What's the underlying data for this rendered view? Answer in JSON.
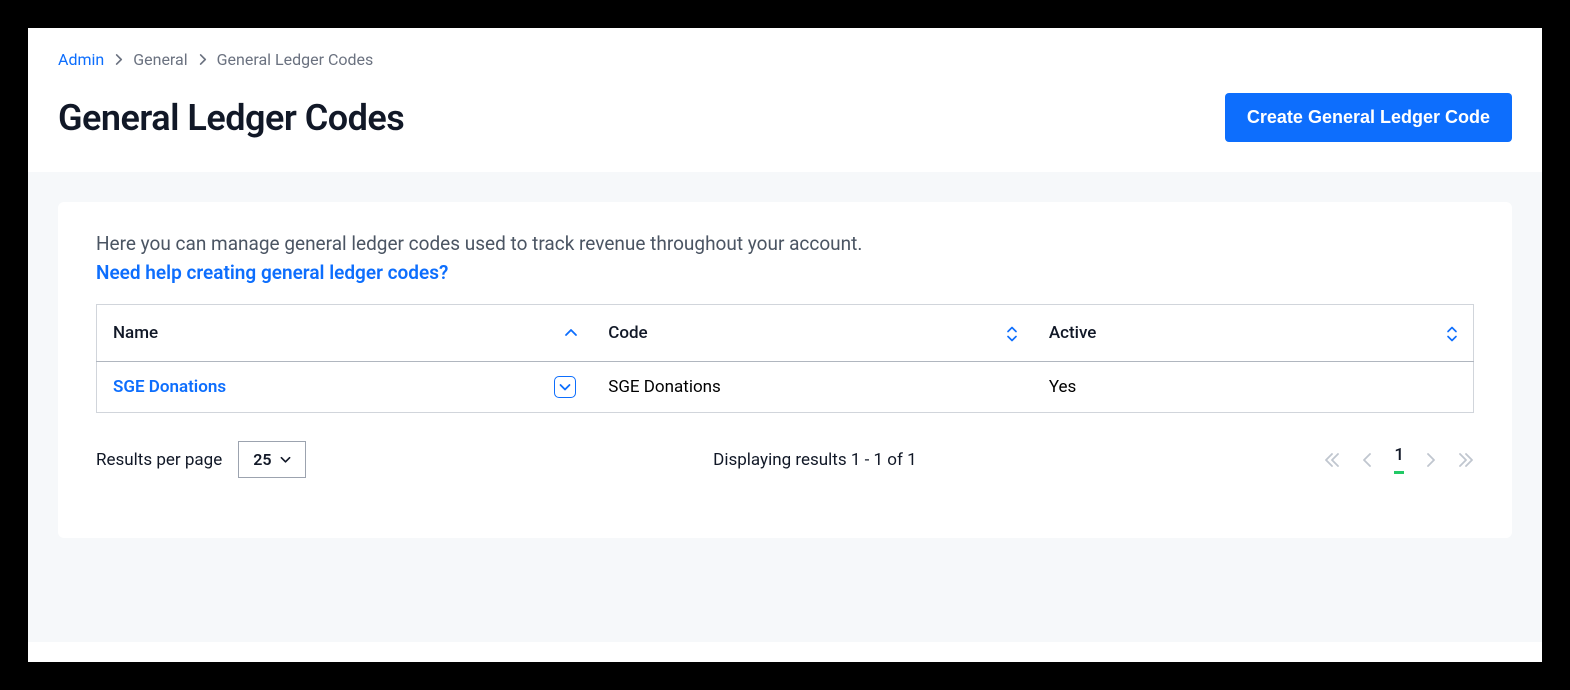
{
  "breadcrumb": {
    "items": [
      {
        "label": "Admin",
        "link": true
      },
      {
        "label": "General",
        "link": false
      },
      {
        "label": "General Ledger Codes",
        "link": false
      }
    ]
  },
  "header": {
    "title": "General Ledger Codes",
    "create_button": "Create General Ledger Code"
  },
  "card": {
    "intro": "Here you can manage general ledger codes used to track revenue throughout your account.",
    "help_link": "Need help creating general ledger codes?"
  },
  "table": {
    "columns": {
      "name": "Name",
      "code": "Code",
      "active": "Active"
    },
    "rows": [
      {
        "name": "SGE Donations",
        "code": "SGE Donations",
        "active": "Yes"
      }
    ]
  },
  "pagination": {
    "per_page_label": "Results per page",
    "per_page_value": "25",
    "displaying_text": "Displaying results 1 - 1 of 1",
    "current_page": "1"
  }
}
